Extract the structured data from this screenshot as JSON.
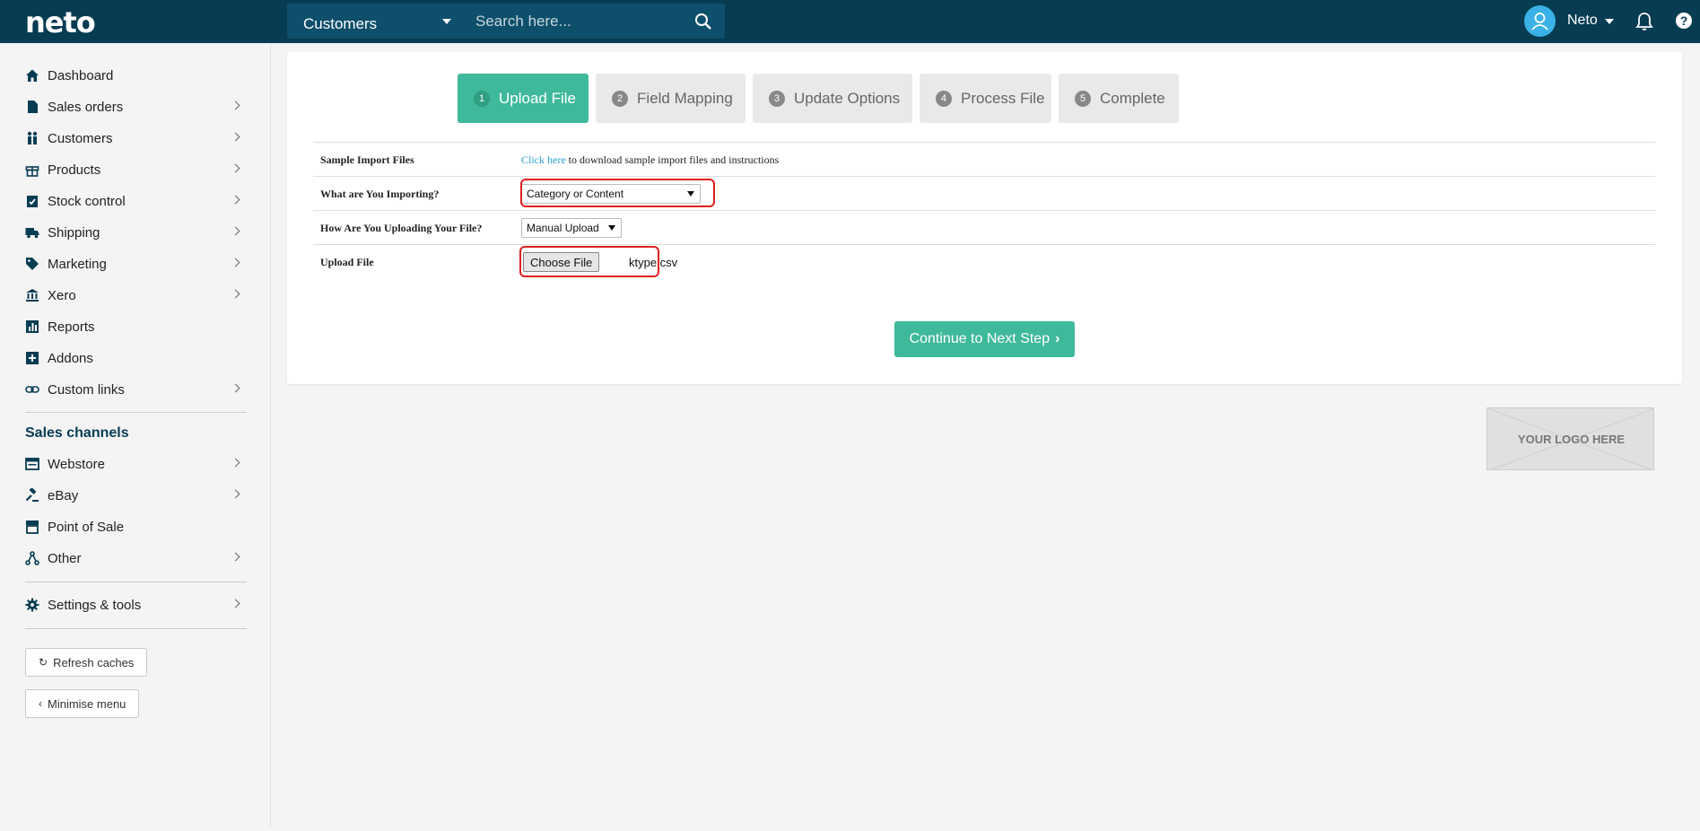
{
  "brand": {
    "logo": "neto"
  },
  "search": {
    "scope": "Customers",
    "placeholder": "Search here..."
  },
  "user": {
    "name": "Neto"
  },
  "sidebar": {
    "items": [
      {
        "label": "Dashboard",
        "icon": "home-icon"
      },
      {
        "label": "Sales orders",
        "icon": "document-icon"
      },
      {
        "label": "Customers",
        "icon": "people-icon"
      },
      {
        "label": "Products",
        "icon": "gift-icon"
      },
      {
        "label": "Stock control",
        "icon": "clipboard-check-icon"
      },
      {
        "label": "Shipping",
        "icon": "truck-icon"
      },
      {
        "label": "Marketing",
        "icon": "tag-icon"
      },
      {
        "label": "Xero",
        "icon": "bank-icon"
      },
      {
        "label": "Reports",
        "icon": "chart-icon"
      },
      {
        "label": "Addons",
        "icon": "plus-square-icon"
      },
      {
        "label": "Custom links",
        "icon": "link-icon"
      }
    ],
    "channels_title": "Sales channels",
    "channels": [
      {
        "label": "Webstore",
        "icon": "browser-icon"
      },
      {
        "label": "eBay",
        "icon": "gavel-icon"
      },
      {
        "label": "Point of Sale",
        "icon": "store-icon"
      },
      {
        "label": "Other",
        "icon": "network-icon"
      }
    ],
    "settings": "Settings & tools",
    "refresh": "Refresh caches",
    "minimise": "Minimise menu"
  },
  "steps": [
    {
      "num": "1",
      "label": "Upload File",
      "active": true
    },
    {
      "num": "2",
      "label": "Field Mapping"
    },
    {
      "num": "3",
      "label": "Update Options"
    },
    {
      "num": "4",
      "label": "Process File"
    },
    {
      "num": "5",
      "label": "Complete"
    }
  ],
  "form": {
    "sample_label": "Sample Import Files",
    "sample_link": "Click here",
    "sample_text": " to download sample import files and instructions",
    "importing_label": "What are You Importing?",
    "importing_value": "Category or Content",
    "uploading_label": "How Are You Uploading Your File?",
    "uploading_value": "Manual Upload",
    "upload_label": "Upload File",
    "choose_button": "Choose File",
    "file_name": "ktype.csv"
  },
  "continue_label": "Continue to Next Step",
  "logo_placeholder": "YOUR LOGO HERE",
  "colors": {
    "topbar": "#073c52",
    "accent": "#3fb99b",
    "link": "#2a9fd6",
    "highlight": "#e02020"
  }
}
